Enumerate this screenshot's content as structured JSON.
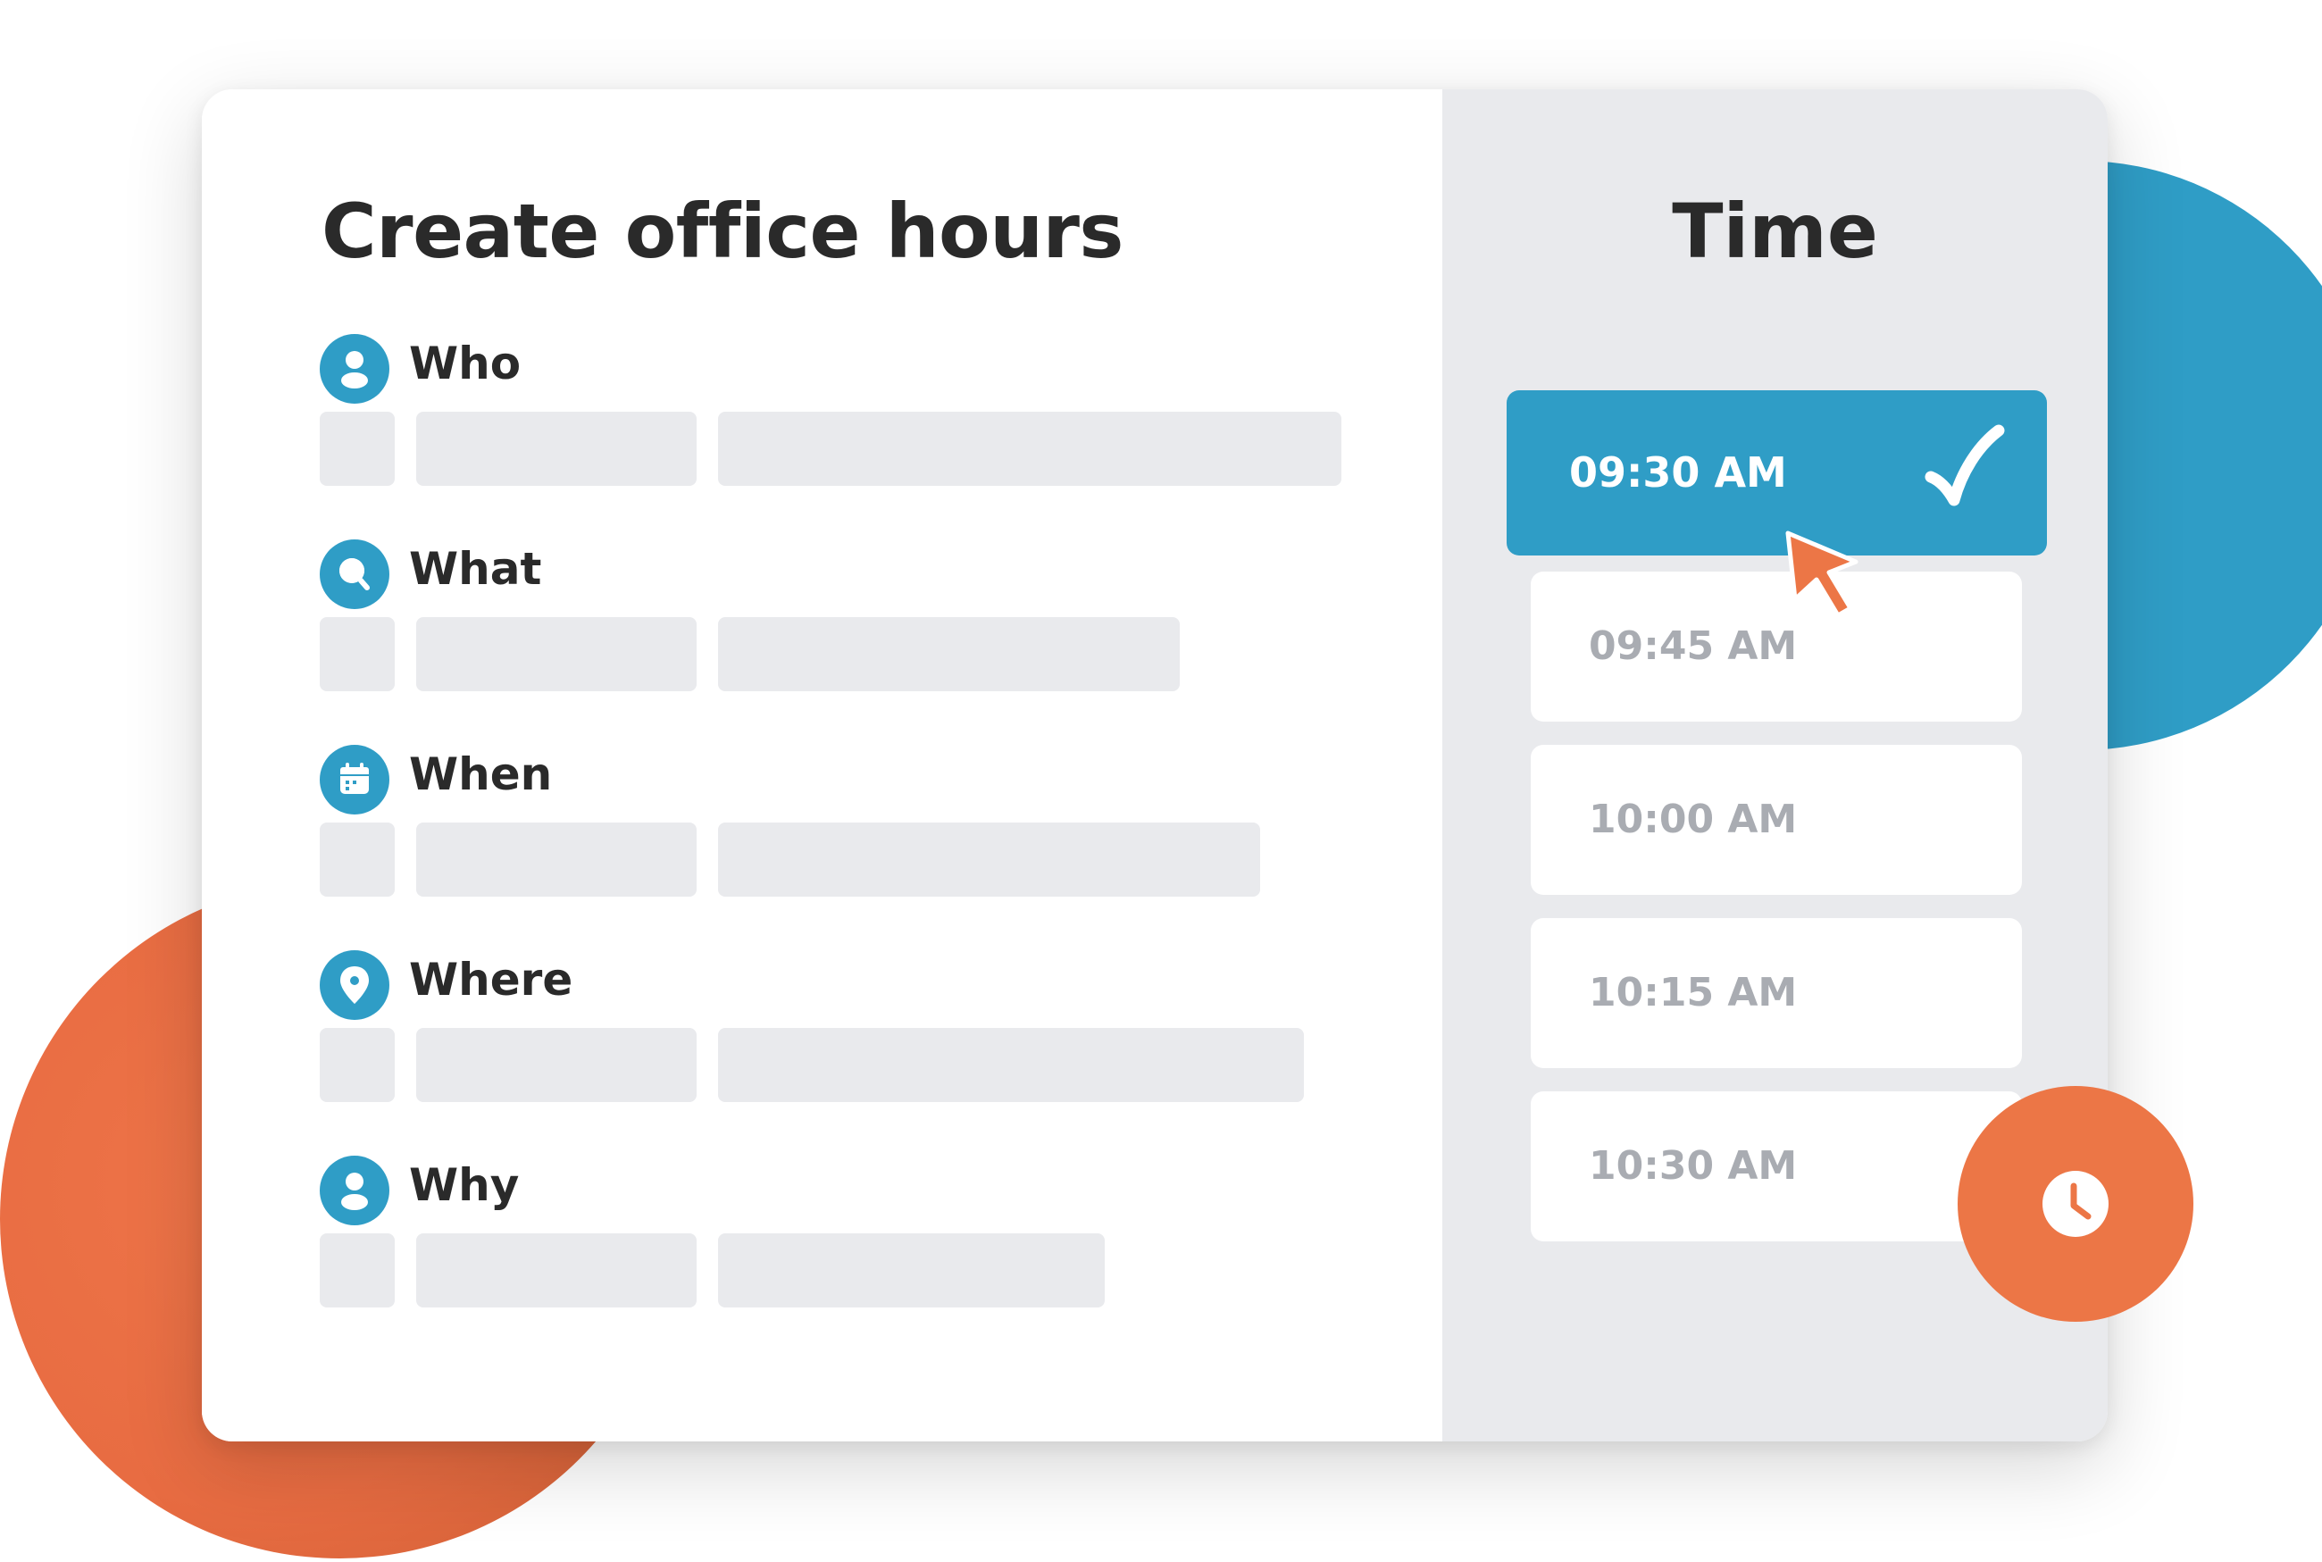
{
  "form": {
    "title": "Create office hours",
    "sections": [
      {
        "label": "Who",
        "icon": "person-icon"
      },
      {
        "label": "What",
        "icon": "search-icon"
      },
      {
        "label": "When",
        "icon": "calendar-icon"
      },
      {
        "label": "Where",
        "icon": "location-pin-icon"
      },
      {
        "label": "Why",
        "icon": "person-icon"
      }
    ]
  },
  "time": {
    "title": "Time",
    "selected": "09:30 AM",
    "slots": [
      "09:30 AM",
      "09:45 AM",
      "10:00 AM",
      "10:15 AM",
      "10:30 AM"
    ]
  },
  "icons": {
    "selected_mark": "checkmark-icon",
    "pointer": "cursor-pointer-icon",
    "badge": "clock-icon"
  },
  "colors": {
    "accent_blue": "#2f9dc6",
    "accent_orange": "#ec7646",
    "placeholder_gray": "#e9eaed",
    "text_dark": "#2a2a2a",
    "text_muted": "#a9acb2"
  }
}
